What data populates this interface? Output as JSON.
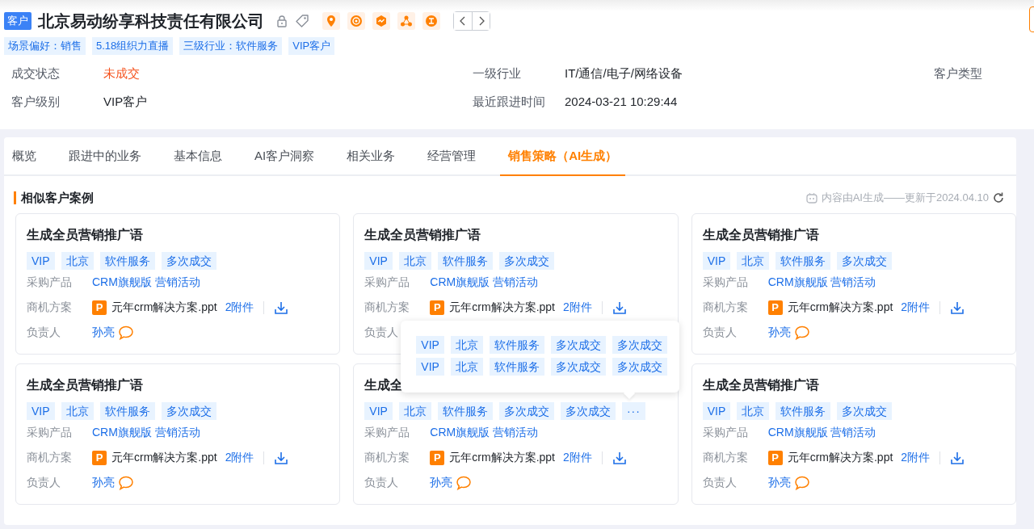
{
  "header": {
    "badge": "客户",
    "company": "北京易动纷享科技责任有限公司",
    "tags": [
      "场景偏好：销售",
      "5.18组织力直播",
      "三级行业：软件服务",
      "VIP客户"
    ],
    "fields": [
      {
        "label": "成交状态",
        "value": "未成交",
        "highlight": true
      },
      {
        "label": "一级行业",
        "value": "IT/通信/电子/网络设备",
        "highlight": false
      },
      {
        "label": "客户类型"
      },
      {
        "label": "客户级别",
        "value": "VIP客户",
        "highlight": false
      },
      {
        "label": "最近跟进时间",
        "value": "2024-03-21 10:29:44",
        "highlight": false
      }
    ]
  },
  "tabs": [
    {
      "label": "概览",
      "selected": false
    },
    {
      "label": "跟进中的业务",
      "selected": false
    },
    {
      "label": "基本信息",
      "selected": false
    },
    {
      "label": "AI客户洞察",
      "selected": false
    },
    {
      "label": "相关业务",
      "selected": false
    },
    {
      "label": "经营管理",
      "selected": false
    },
    {
      "label": "销售策略（AI生成）",
      "selected": true
    }
  ],
  "section": {
    "title": "相似客户案例",
    "note": "内容由AI生成——更新于2024.04.10"
  },
  "cards": [
    {
      "title": "生成全员营销推广语",
      "tags": [
        "VIP",
        "北京",
        "软件服务",
        "多次成交"
      ],
      "rows": {
        "product_label": "采购产品",
        "products": "CRM旗舰版 营销活动",
        "plan_label": "商机方案",
        "file_badge": "P",
        "file": "元年crm解决方案.ppt",
        "attachments": "2附件",
        "owner_label": "负责人",
        "owner": "孙亮"
      }
    },
    {
      "title": "生成全员营销推广语",
      "tags": [
        "VIP",
        "北京",
        "软件服务",
        "多次成交"
      ],
      "rows": {
        "product_label": "采购产品",
        "products": "CRM旗舰版 营销活动",
        "plan_label": "商机方案",
        "file_badge": "P",
        "file": "元年crm解决方案.ppt",
        "attachments": "2附件",
        "owner_label": "负责人"
      }
    },
    {
      "title": "生成全员营销推广语",
      "tags": [
        "VIP",
        "北京",
        "软件服务",
        "多次成交"
      ],
      "rows": {
        "product_label": "采购产品",
        "products": "CRM旗舰版 营销活动",
        "plan_label": "商机方案",
        "file_badge": "P",
        "file": "元年crm解决方案.ppt",
        "attachments": "2附件",
        "owner_label": "负责人",
        "owner": "孙亮"
      }
    },
    {
      "title": "生成全员营销推广语",
      "tags": [
        "VIP",
        "北京",
        "软件服务",
        "多次成交"
      ],
      "rows": {
        "product_label": "采购产品",
        "products": "CRM旗舰版 营销活动",
        "plan_label": "商机方案",
        "file_badge": "P",
        "file": "元年crm解决方案.ppt",
        "attachments": "2附件",
        "owner_label": "负责人",
        "owner": "孙亮"
      }
    },
    {
      "title": "生成全",
      "tags": [
        "VIP",
        "北京",
        "软件服务",
        "多次成交",
        "多次成交"
      ],
      "more": "···",
      "popover": [
        [
          "VIP",
          "北京",
          "软件服务",
          "多次成交",
          "多次成交"
        ],
        [
          "VIP",
          "北京",
          "软件服务",
          "多次成交",
          "多次成交"
        ]
      ],
      "rows": {
        "product_label": "采购产品",
        "products": "CRM旗舰版 营销活动",
        "plan_label": "商机方案",
        "file_badge": "P",
        "file": "元年crm解决方案.ppt",
        "attachments": "2附件",
        "owner_label": "负责人",
        "owner": "孙亮"
      }
    },
    {
      "title": "生成全员营销推广语",
      "tags": [
        "VIP",
        "北京",
        "软件服务",
        "多次成交"
      ],
      "rows": {
        "product_label": "采购产品",
        "products": "CRM旗舰版 营销活动",
        "plan_label": "商机方案",
        "file_badge": "P",
        "file": "元年crm解决方案.ppt",
        "attachments": "2附件",
        "owner_label": "负责人",
        "owner": "孙亮"
      }
    }
  ]
}
